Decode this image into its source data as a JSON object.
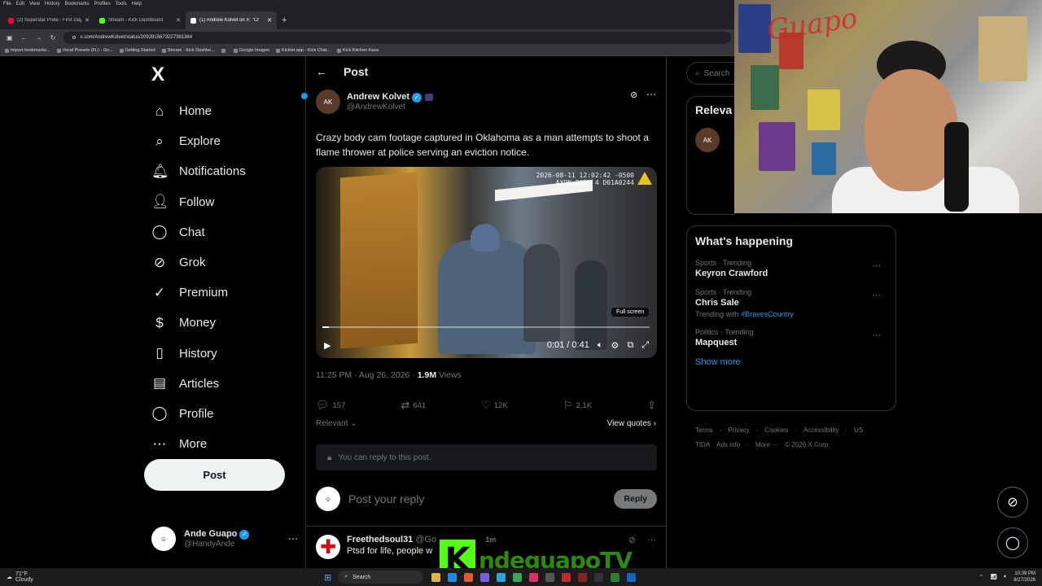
{
  "browser": {
    "menu": [
      "File",
      "Edit",
      "View",
      "History",
      "Bookmarks",
      "Profiles",
      "Tools",
      "Help"
    ],
    "tabs": [
      {
        "title": "(2) Superstar Pride - First Day O",
        "color": "#ff0033",
        "active": false
      },
      {
        "title": "Stream - Kick Dashboard",
        "color": "#53fc18",
        "active": false
      },
      {
        "title": "(1) Andrew Kolvet on X: \"Cr",
        "color": "#ffffff",
        "active": true
      }
    ],
    "new_tab": "+",
    "url": "x.com/AndrewKolvet/status/2092815673227391384",
    "bookmarks": [
      "Import bookmarks...",
      "Vocal Presets (FL) - Go...",
      "Getting Started",
      "Stream - Kick Dashbo...",
      "",
      "Google Images",
      "Kicklet.app - Kick Chat...",
      "Kick Kitchen Kaos"
    ]
  },
  "nav": {
    "logo": "X",
    "items": [
      {
        "label": "Home",
        "icon": "⌂",
        "name": "home"
      },
      {
        "label": "Explore",
        "icon": "⌕",
        "name": "explore"
      },
      {
        "label": "Notifications",
        "icon": "🔔︎",
        "name": "notifications"
      },
      {
        "label": "Follow",
        "icon": "👤︎",
        "name": "follow"
      },
      {
        "label": "Chat",
        "icon": "◯",
        "name": "chat"
      },
      {
        "label": "Grok",
        "icon": "⊘",
        "name": "grok"
      },
      {
        "label": "Premium",
        "icon": "✓",
        "name": "premium"
      },
      {
        "label": "Money",
        "icon": "$",
        "name": "money"
      },
      {
        "label": "History",
        "icon": "▯",
        "name": "history"
      },
      {
        "label": "Articles",
        "icon": "▤",
        "name": "articles"
      },
      {
        "label": "Profile",
        "icon": "◯",
        "name": "profile"
      },
      {
        "label": "More",
        "icon": "⋯",
        "name": "more"
      }
    ],
    "post_label": "Post",
    "me": {
      "name": "Ande Guapo",
      "handle": "@HandyAnde",
      "more": "⋯"
    }
  },
  "post": {
    "header": "Post",
    "back": "←",
    "author": {
      "name": "Andrew Kolvet",
      "handle": "@AndrewKolvet"
    },
    "text": "Crazy body cam footage captured in Oklahoma as a man attempts to shoot a flame thrower at police serving an eviction notice.",
    "video": {
      "stamp_line1": "2026-08-11 12:02:42 -0500",
      "stamp_line2": "AXON BODY 4 D01A0244",
      "tooltip": "Full screen",
      "time": "0:01 / 0:41",
      "progress": 0.02
    },
    "meta": {
      "time": "11:25 PM · Aug 26, 2026 · ",
      "views": "1.9M",
      "views_label": " Views"
    },
    "stats": {
      "replies": "157",
      "reposts": "641",
      "likes": "12K",
      "bookmarks": "2.1K"
    },
    "relevant": "Relevant ⌄",
    "view_quotes": "View quotes ›",
    "locked_text": "You can reply to this post.",
    "reply_placeholder": "Post your reply",
    "reply_button": "Reply"
  },
  "comment": {
    "name": "Freethedsoul31",
    "handle": "@Go",
    "time": "1m",
    "text": "Ptsd for life, people w"
  },
  "right": {
    "search_placeholder": "Search",
    "relevant_title": "Releva",
    "happening_title": "What's happening",
    "trends": [
      {
        "category": "Sports · Trending",
        "name": "Keyron Crawford",
        "sub": ""
      },
      {
        "category": "Sports · Trending",
        "name": "Chris Sale",
        "sub_prefix": "Trending with ",
        "sub_link": "#BravesCountry"
      },
      {
        "category": "Politics · Trending",
        "name": "Mapquest",
        "sub": ""
      }
    ],
    "show_more": "Show more",
    "footer": [
      "Terms",
      "·",
      "Privacy",
      "·",
      "Cookies",
      "·",
      "Accessibility",
      "·",
      "US TIDA",
      "Ads info",
      "·",
      "More ···",
      "© 2026 X Corp."
    ]
  },
  "overlay": {
    "cam_text": "Guapo",
    "watermark_k": "K",
    "watermark_name": "ndeguapoTV"
  },
  "taskbar": {
    "temp": "71°F",
    "weather": "Cloudy",
    "search": "Search",
    "time": "10:39 PM",
    "date": "8/27/2026"
  },
  "colors": {
    "accent": "#1d9bf0",
    "kick": "#53fc18",
    "bg": "#000000"
  }
}
